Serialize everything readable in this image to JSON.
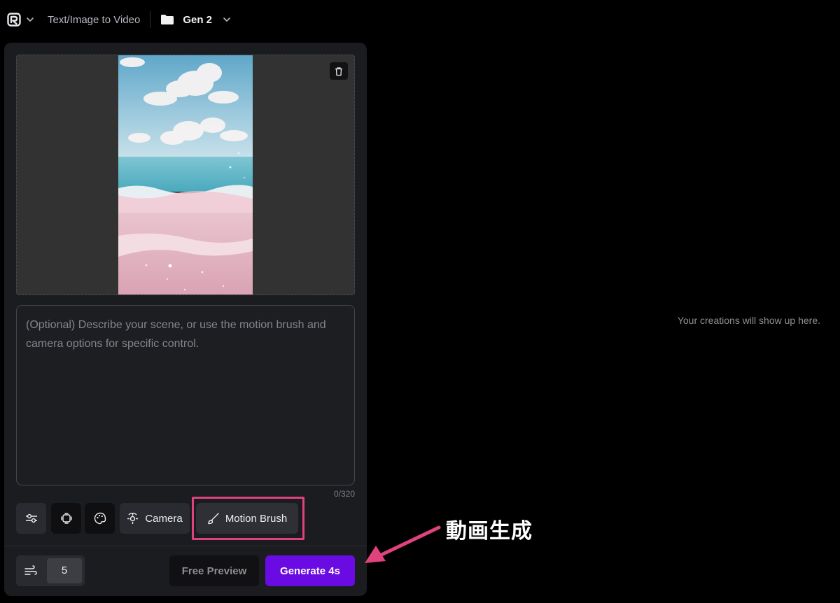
{
  "header": {
    "app_mode": "Text/Image to Video",
    "folder": "Gen 2"
  },
  "image": {
    "description_icon": "beach-scene-image"
  },
  "prompt": {
    "placeholder": "(Optional) Describe your scene, or use the motion brush and camera options for specific control.",
    "value": "",
    "counter": "0/320"
  },
  "tools": {
    "camera_label": "Camera",
    "motion_brush_label": "Motion Brush"
  },
  "footer": {
    "duration_value": "5",
    "free_preview_label": "Free Preview",
    "generate_label": "Generate 4s"
  },
  "main": {
    "empty_message": "Your creations will show up here."
  },
  "annotation": {
    "text": "動画生成"
  },
  "colors": {
    "accent": "#6a0be4",
    "highlight": "#e0427d",
    "panel": "#1b1c20"
  }
}
